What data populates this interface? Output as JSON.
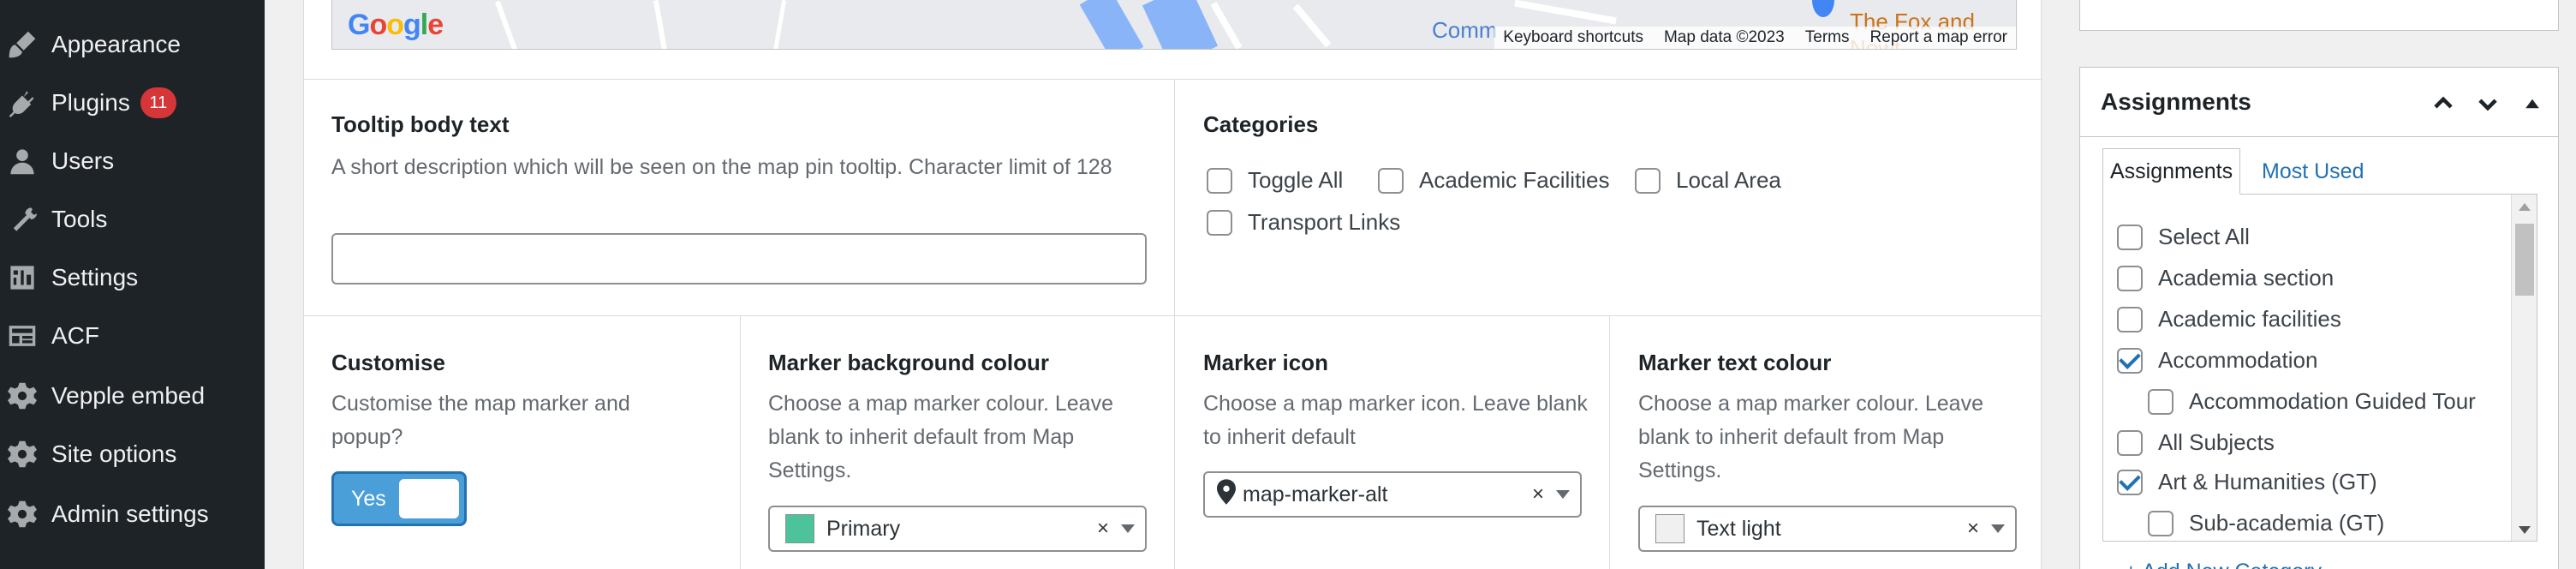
{
  "sidebar": {
    "items": [
      {
        "label": "Appearance",
        "icon": "paintbrush-icon"
      },
      {
        "label": "Plugins",
        "icon": "plugin-icon",
        "badge": "11"
      },
      {
        "label": "Users",
        "icon": "users-icon"
      },
      {
        "label": "Tools",
        "icon": "wrench-icon"
      },
      {
        "label": "Settings",
        "icon": "settings-icon"
      },
      {
        "label": "ACF",
        "icon": "acf-icon"
      },
      {
        "label": "Vepple embed",
        "icon": "gear-icon"
      },
      {
        "label": "Site options",
        "icon": "gear-icon"
      },
      {
        "label": "Admin settings",
        "icon": "gear-icon"
      }
    ]
  },
  "map": {
    "logo": "Google",
    "label_comm": "Comm",
    "label_fox": "The Fox and Nowt",
    "attrib": {
      "shortcuts": "Keyboard shortcuts",
      "data": "Map data ©2023",
      "terms": "Terms",
      "report": "Report a map error"
    }
  },
  "tooltip": {
    "label": "Tooltip body text",
    "description": "A short description which will be seen on the map pin tooltip. Character limit of 128",
    "value": ""
  },
  "categories": {
    "label": "Categories",
    "options": [
      {
        "label": "Toggle All",
        "checked": false
      },
      {
        "label": "Academic Facilities",
        "checked": false
      },
      {
        "label": "Local Area",
        "checked": false
      },
      {
        "label": "Transport Links",
        "checked": false
      }
    ]
  },
  "customise": {
    "label": "Customise",
    "description": "Customise the map marker and popup?",
    "toggle_label": "Yes"
  },
  "marker_bg": {
    "label": "Marker background colour",
    "description": "Choose a map marker colour. Leave blank to inherit default from Map Settings.",
    "value": "Primary",
    "swatch": "#4cc39a"
  },
  "marker_icon": {
    "label": "Marker icon",
    "description": "Choose a map marker icon. Leave blank to inherit default",
    "value": "map-marker-alt",
    "icon": "map-marker-icon"
  },
  "marker_text": {
    "label": "Marker text colour",
    "description": "Choose a map marker colour. Leave blank to inherit default from Map Settings.",
    "value": "Text light",
    "swatch": "#f0f0f1"
  },
  "clear_symbol": "×",
  "assignments": {
    "title": "Assignments",
    "tabs": [
      "Assignments",
      "Most Used"
    ],
    "items": [
      {
        "label": "Select All",
        "checked": false,
        "indent": false
      },
      {
        "label": "Academia section",
        "checked": false,
        "indent": false
      },
      {
        "label": "Academic facilities",
        "checked": false,
        "indent": false
      },
      {
        "label": "Accommodation",
        "checked": true,
        "indent": false
      },
      {
        "label": "Accommodation Guided Tour",
        "checked": false,
        "indent": true
      },
      {
        "label": "All Subjects",
        "checked": false,
        "indent": false
      },
      {
        "label": "Art & Humanities (GT)",
        "checked": true,
        "indent": false
      },
      {
        "label": "Sub-academia (GT)",
        "checked": false,
        "indent": true
      }
    ],
    "add_new": "+ Add New Category"
  },
  "colors": {
    "accent": "#2271b1",
    "sidebar_bg": "#1d2327",
    "badge": "#d63638",
    "toggle": "#4a9fd8"
  }
}
